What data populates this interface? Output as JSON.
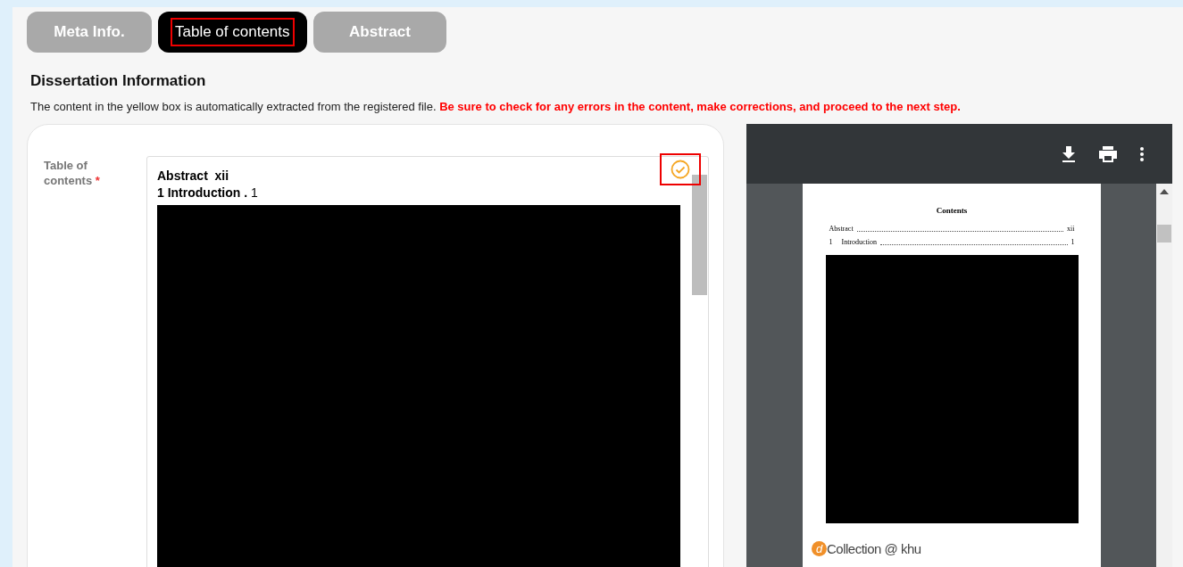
{
  "tabs": [
    {
      "label": "Meta Info.",
      "selected": false
    },
    {
      "label": "Table of contents",
      "selected": true
    },
    {
      "label": "Abstract",
      "selected": false
    }
  ],
  "section": {
    "title": "Dissertation Information",
    "notice": "The content in the yellow box is automatically extracted from the registered file.",
    "warning": "Be sure to check for any errors in the content, make corrections, and proceed to the next step."
  },
  "field": {
    "label": "Table of contents",
    "required_mark": "*",
    "lines": [
      {
        "title": "Abstract  xii"
      },
      {
        "title": "1 Introduction .",
        "page": "1"
      }
    ],
    "verified": true
  },
  "pdf_viewer": {
    "page_title": "Contents",
    "entries": [
      {
        "title": "Abstract",
        "page": "xii"
      },
      {
        "number": "1",
        "title": "Introduction",
        "page": "1"
      }
    ],
    "footer_logo_mark": "d",
    "footer_logo_text": "Collection @ khu"
  }
}
